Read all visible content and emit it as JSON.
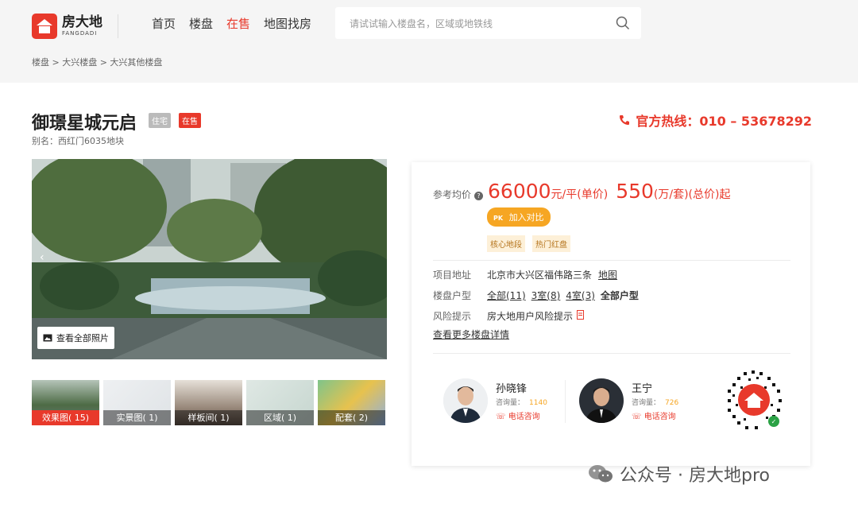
{
  "brand": {
    "name_cn": "房大地",
    "name_en": "FANGDADI",
    "color": "#e8392b"
  },
  "nav": [
    {
      "label": "首页",
      "active": false
    },
    {
      "label": "楼盘",
      "active": false
    },
    {
      "label": "在售",
      "active": true
    },
    {
      "label": "地图找房",
      "active": false
    }
  ],
  "search": {
    "placeholder": "请试试输入楼盘名，区域或地铁线"
  },
  "breadcrumb": "楼盘 > 大兴楼盘 > 大兴其他楼盘",
  "project": {
    "title": "御璟星城元启",
    "tag_type": "住宅",
    "tag_status": "在售",
    "alias": "别名：西红门6035地块",
    "hotline": "官方热线：010 – 53678292"
  },
  "gallery": {
    "view_all": "查看全部照片",
    "thumbs": [
      {
        "label": "效果图( 15)",
        "active": true
      },
      {
        "label": "实景图( 1)",
        "active": false
      },
      {
        "label": "样板间( 1)",
        "active": false
      },
      {
        "label": "区域( 1)",
        "active": false
      },
      {
        "label": "配套( 2)",
        "active": false
      }
    ]
  },
  "price": {
    "label": "参考均价",
    "unit_price": "66000",
    "unit_price_suffix": "元/平(单价)",
    "total_price": "550",
    "total_price_suffix": "(万/套)(总价)起",
    "pk_badge": "PK",
    "compare_label": "加入对比",
    "features": [
      "核心地段",
      "热门红盘"
    ]
  },
  "details": {
    "address_label": "项目地址",
    "address": "北京市大兴区福伟路三条",
    "map_link": "地图",
    "layout_label": "楼盘户型",
    "layouts": [
      "全部(11)",
      "3室(8)",
      "4室(3)"
    ],
    "layout_all": "全部户型",
    "risk_label": "风险提示",
    "risk_text": "房大地用户风险提示",
    "more_link": "查看更多楼盘详情"
  },
  "agents": [
    {
      "name": "孙晓锋",
      "query_label": "咨询量：",
      "query_count": "1140",
      "call": "电话咨询"
    },
    {
      "name": "王宁",
      "query_label": "咨询量：",
      "query_count": "726",
      "call": "电话咨询"
    }
  ],
  "watermark": "公众号 · 房大地pro"
}
